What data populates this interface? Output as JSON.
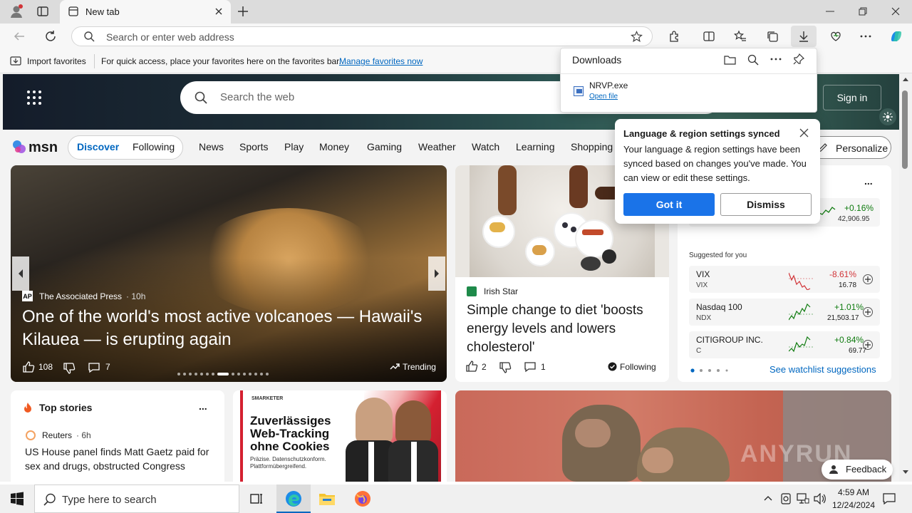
{
  "browser": {
    "tab_title": "New tab",
    "address_placeholder": "Search or enter web address"
  },
  "favorites_bar": {
    "import_label": "Import favorites",
    "hint": "For quick access, place your favorites here on the favorites bar.",
    "manage_link": "Manage favorites now"
  },
  "downloads": {
    "title": "Downloads",
    "file_name": "NRVP.exe",
    "open_file": "Open file"
  },
  "msn": {
    "search_placeholder": "Search the web",
    "sign_in": "Sign in",
    "logo": "msn",
    "tabs": [
      "Discover",
      "Following"
    ],
    "nav": [
      "News",
      "Sports",
      "Play",
      "Money",
      "Gaming",
      "Weather",
      "Watch",
      "Learning",
      "Shopping"
    ],
    "personalize": "Personalize"
  },
  "lang_popup": {
    "title": "Language & region settings synced",
    "body": "Your language & region settings have been synced based on changes you've made. You can view or edit these settings.",
    "got_it": "Got it",
    "dismiss": "Dismiss"
  },
  "hero_story": {
    "source": "The Associated Press",
    "age": "10h",
    "headline": "One of the world's most active volcanoes — Hawaii's Kilauea — is erupting again",
    "likes": "108",
    "comments": "7",
    "trending": "Trending"
  },
  "side_story": {
    "source": "Irish Star",
    "headline": "Simple change to diet 'boosts energy levels and lowers cholesterol'",
    "likes": "2",
    "comments": "1",
    "following": "Following"
  },
  "watchlist": {
    "more": "...",
    "top_change": "+0.16%",
    "top_value": "42,906.95",
    "suggested_label": "Suggested for you",
    "stocks": [
      {
        "name": "VIX",
        "ticker": "VIX",
        "change": "-8.61%",
        "value": "16.78",
        "color": "#d13438"
      },
      {
        "name": "Nasdaq 100",
        "ticker": "NDX",
        "change": "+1.01%",
        "value": "21,503.17",
        "color": "#0f7b0f"
      },
      {
        "name": "CITIGROUP INC.",
        "ticker": "C",
        "change": "+0.84%",
        "value": "69.77",
        "color": "#0f7b0f"
      }
    ],
    "see_suggestions": "See watchlist suggestions"
  },
  "top_stories": {
    "title": "Top stories",
    "more": "...",
    "source": "Reuters",
    "age": "6h",
    "headline": "US House panel finds Matt Gaetz paid for sex and drugs, obstructed Congress"
  },
  "ad": {
    "brand": "SMARKETER",
    "headline": "Zuverlässiges Web-Tracking ohne Cookies",
    "sub": "Präzise. Datenschutzkonform. Plattformübergreifend."
  },
  "feedback": "Feedback",
  "taskbar": {
    "search_placeholder": "Type here to search",
    "time": "4:59 AM",
    "date": "12/24/2024"
  },
  "colors": {
    "accent": "#0067c0",
    "got_it_bg": "#1a73e8",
    "positive": "#0f7b0f",
    "negative": "#d13438"
  }
}
